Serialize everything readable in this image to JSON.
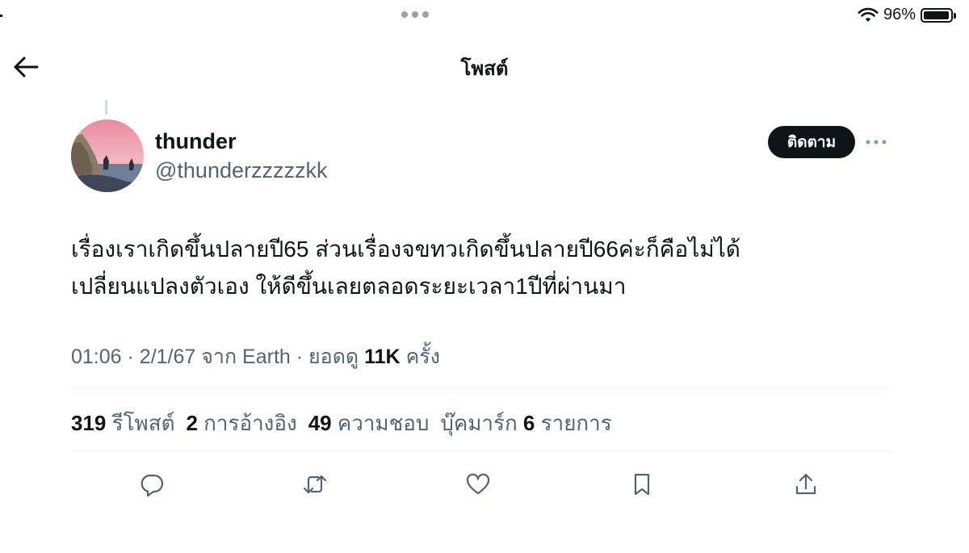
{
  "status_bar": {
    "battery": "96%",
    "battery_level": 0.96
  },
  "header": {
    "title": "โพสต์"
  },
  "author": {
    "display_name": "thunder",
    "handle": "@thunderzzzzzkk"
  },
  "follow_label": "ติดตาม",
  "tweet": {
    "lines": [
      "เรื่องเราเกิดขึ้นปลายปี65 ส่วนเรื่องจขทวเกิดขึ้นปลายปี66ค่ะก็คือไม่ได้",
      "เปลี่ยนแปลงตัวเอง ให้ดีขึ้นเลยตลอดระยะเวลา1ปีที่ผ่านมา"
    ]
  },
  "meta": {
    "time": "01:06",
    "date": "2/1/67",
    "source": "จาก Earth",
    "views_label": "ยอดดู",
    "views_count": "11K",
    "views_suffix": "ครั้ง"
  },
  "stats": {
    "reposts_count": "319",
    "reposts_label": "รีโพสต์",
    "quotes_count": "2",
    "quotes_label": "การอ้างอิง",
    "likes_count": "49",
    "likes_label": "ความชอบ",
    "bookmarks_label": "บุ๊คมาร์ก",
    "bookmarks_count": "6",
    "bookmarks_suffix": "รายการ"
  },
  "actions": [
    "reply-icon",
    "repost-icon",
    "like-icon",
    "bookmark-icon",
    "share-icon"
  ],
  "colors": {
    "text": "#0f1419",
    "secondary": "#536471",
    "follow_bg": "#0f1419",
    "divider": "#eff3f4"
  }
}
